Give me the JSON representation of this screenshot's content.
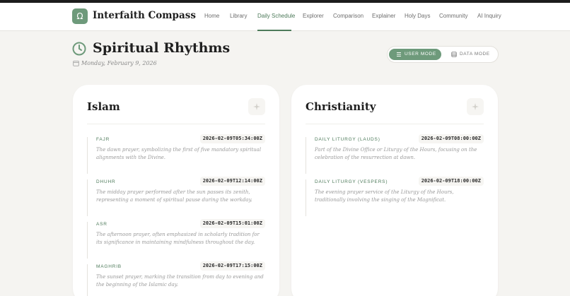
{
  "app": {
    "logo_glyph": "Ω",
    "brand": "Interfaith Compass",
    "accent_color": "#6e9a7b"
  },
  "nav": {
    "items": [
      {
        "label": "Home"
      },
      {
        "label": "Library"
      },
      {
        "label": "Daily Schedule",
        "active": true
      },
      {
        "label": "Explorer"
      },
      {
        "label": "Comparison"
      },
      {
        "label": "Explainer"
      },
      {
        "label": "Holy Days"
      },
      {
        "label": "Community"
      },
      {
        "label": "AI Inquiry"
      }
    ]
  },
  "page": {
    "title_icon": "clock-icon",
    "title": "Spiritual Rhythms",
    "date": "Monday, February 9, 2026"
  },
  "mode_toggle": {
    "user_label": "USER MODE",
    "data_label": "DATA MODE",
    "selected": "USER MODE"
  },
  "traditions": [
    {
      "name": "Islam",
      "icon": "sparkle-icon",
      "entries": [
        {
          "name": "FAJR",
          "time": "2026-02-09T05:34:00Z",
          "desc": "The dawn prayer, symbolizing the first of five mandatory spiritual alignments with the Divine."
        },
        {
          "name": "DHUHR",
          "time": "2026-02-09T12:14:00Z",
          "desc": "The midday prayer performed after the sun passes its zenith, representing a moment of spiritual pause during the workday."
        },
        {
          "name": "ASR",
          "time": "2026-02-09T15:01:00Z",
          "desc": "The afternoon prayer, often emphasized in scholarly tradition for its significance in maintaining mindfulness throughout the day."
        },
        {
          "name": "MAGHRIB",
          "time": "2026-02-09T17:15:00Z",
          "desc": "The sunset prayer, marking the transition from day to evening and the beginning of the Islamic day."
        }
      ]
    },
    {
      "name": "Christianity",
      "icon": "sparkle-icon",
      "entries": [
        {
          "name": "DAILY LITURGY (LAUDS)",
          "time": "2026-02-09T08:00:00Z",
          "desc": "Part of the Divine Office or Liturgy of the Hours, focusing on the celebration of the resurrection at dawn."
        },
        {
          "name": "DAILY LITURGY (VESPERS)",
          "time": "2026-02-09T18:00:00Z",
          "desc": "The evening prayer service of the Liturgy of the Hours, traditionally involving the singing of the Magnificat."
        }
      ]
    }
  ]
}
